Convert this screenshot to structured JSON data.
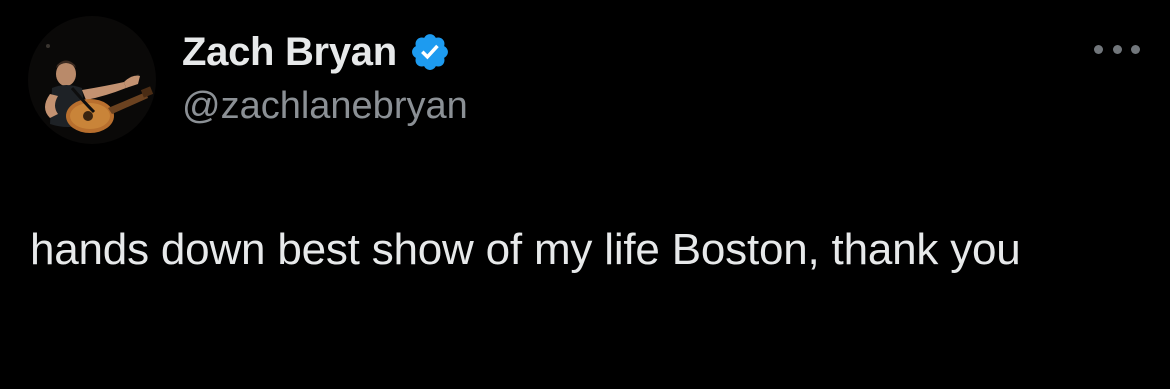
{
  "tweet": {
    "author": {
      "display_name": "Zach Bryan",
      "handle": "@zachlanebryan",
      "verified": true,
      "avatar_icon": "avatar-photo-guitarist"
    },
    "more_icon": "more-horizontal-icon",
    "text": "hands down best show of my life Boston, thank you"
  },
  "colors": {
    "background": "#000000",
    "primary_text": "#e7e9ea",
    "secondary_text": "#8b9095",
    "verified_badge": "#1d9bf0",
    "more_dots": "#71767b"
  }
}
